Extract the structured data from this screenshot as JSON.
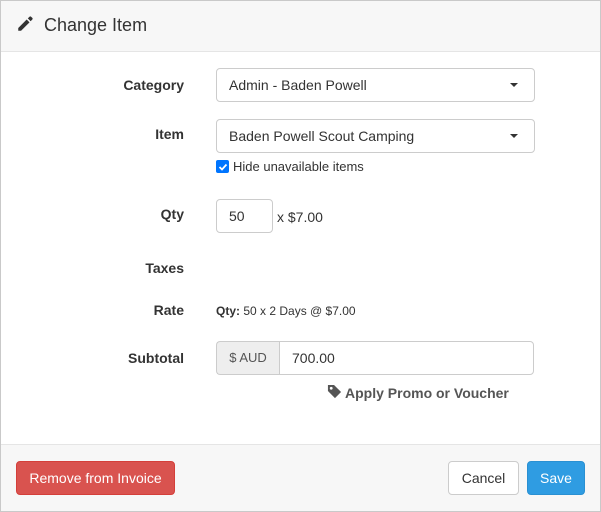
{
  "header": {
    "title": "Change Item",
    "icon": "pencil-icon"
  },
  "form": {
    "category": {
      "label": "Category",
      "value": "Admin - Baden Powell"
    },
    "item": {
      "label": "Item",
      "value": "Baden Powell Scout Camping"
    },
    "hide_unavailable": {
      "label": "Hide unavailable items",
      "checked": true
    },
    "qty": {
      "label": "Qty",
      "value": "50",
      "price": "x $7.00"
    },
    "taxes": {
      "label": "Taxes"
    },
    "rate": {
      "label": "Rate",
      "prefix": "Qty:",
      "text": "50 x 2 Days @ $7.00"
    },
    "subtotal": {
      "label": "Subtotal",
      "currency": "$ AUD",
      "value": "700.00"
    },
    "promo": {
      "label": "Apply Promo or Voucher",
      "icon": "tag-icon"
    }
  },
  "footer": {
    "remove_label": "Remove from Invoice",
    "cancel_label": "Cancel",
    "save_label": "Save"
  },
  "colors": {
    "danger": "#d9534f",
    "primary": "#2f9ce2",
    "checkbox": "#0075ff"
  }
}
